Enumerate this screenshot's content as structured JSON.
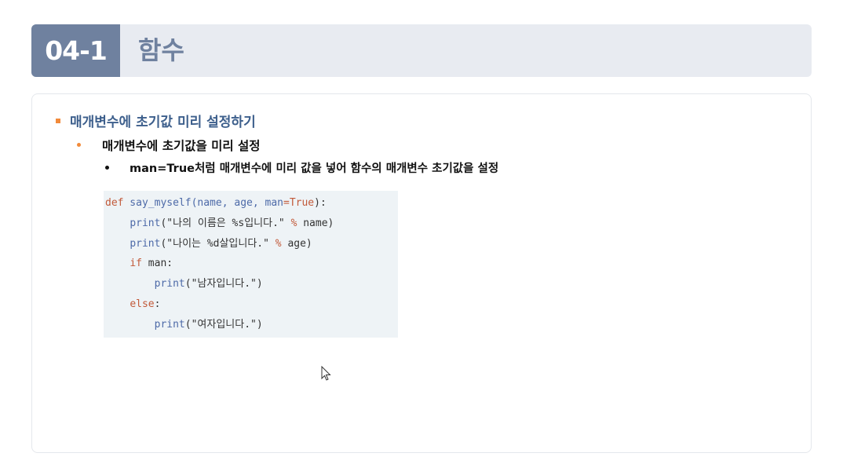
{
  "header": {
    "section_number": "04-1",
    "section_title": "함수"
  },
  "content": {
    "level1": "매개변수에 초기값 미리 설정하기",
    "level2": "매개변수에 초기값을 미리 설정",
    "level3": "man=True처럼 매개변수에 미리 값을 넣어 함수의 매개변수 초기값을 설정"
  },
  "code": {
    "line1": {
      "def": "def",
      "sig": " say_myself(name, age, man",
      "eq": "=",
      "true": "True",
      "end": "):"
    },
    "line2": {
      "call": "print",
      "str": "(\"나의 이름은 %s입니다.\" ",
      "op": "%",
      "rest": " name)"
    },
    "line3": {
      "call": "print",
      "str": "(\"나이는 %d살입니다.\" ",
      "op": "%",
      "rest": " age)"
    },
    "line4": {
      "kw": "if",
      "rest": " man:"
    },
    "line5": {
      "call": "print",
      "rest": "(\"남자입니다.\")"
    },
    "line6": {
      "kw": "else",
      "rest": ":"
    },
    "line7": {
      "call": "print",
      "rest": "(\"여자입니다.\")"
    }
  },
  "colors": {
    "header_dark": "#6f819f",
    "header_light": "#e8ebf1",
    "bullet_accent": "#f28a3a",
    "title_blue": "#3d5f8c",
    "code_bg": "#eef3f6"
  }
}
